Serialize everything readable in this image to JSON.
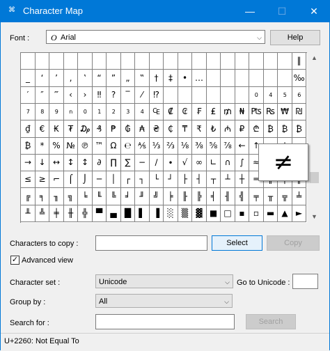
{
  "window": {
    "title": "Character Map",
    "icon": "charmap-app-icon",
    "controls": {
      "minimize": "—",
      "maximize": "☐",
      "close": "✕"
    },
    "accent_color": "#0078d7"
  },
  "font": {
    "label": "Font :",
    "value": "Arial",
    "glyph": "O",
    "help_label": "Help"
  },
  "grid": {
    "rows": [
      [
        "",
        "",
        "",
        "",
        "",
        "",
        "",
        "",
        "",
        "",
        "",
        "",
        "",
        "",
        "",
        "",
        "",
        "",
        "",
        "‖"
      ],
      [
        "_",
        "‘",
        "’",
        "‚",
        "‛",
        "“",
        "”",
        "„",
        "‟",
        "†",
        "‡",
        "•",
        "…",
        "",
        "",
        "",
        "",
        "",
        "",
        "‰"
      ],
      [
        "′",
        "″",
        "‴",
        "‹",
        "›",
        "‼",
        "?",
        "‾",
        "⁄",
        "⁉",
        "",
        "",
        "",
        "",
        "",
        "",
        "0",
        "4",
        "5",
        "6"
      ],
      [
        "7",
        "8",
        "9",
        "n",
        "0",
        "1",
        "2",
        "3",
        "4",
        "₠",
        "₡",
        "₢",
        "₣",
        "₤",
        "₥",
        "₦",
        "₧",
        "₨",
        "₩",
        "₪"
      ],
      [
        "₫",
        "€",
        "₭",
        "₮",
        "₯",
        "₰",
        "₱",
        "₲",
        "₳",
        "₴",
        "₵",
        "₸",
        "₹",
        "₺",
        "₼",
        "₽",
        "₾",
        "₿",
        "₿",
        "₿"
      ],
      [
        "₿",
        "*",
        "%",
        "№",
        "℗",
        "™",
        "Ω",
        "℮",
        "⅍",
        "⅓",
        "⅔",
        "⅛",
        "⅜",
        "⅝",
        "⅞",
        "←",
        "↑",
        "→",
        "↓",
        "↔"
      ],
      [
        "→",
        "↓",
        "↔",
        "↕",
        "↕",
        "∂",
        "∏",
        "∑",
        "−",
        "∕",
        "∙",
        "√",
        "∞",
        "∟",
        "∩",
        "∫",
        "≈",
        "≠",
        "≡",
        ""
      ],
      [
        "≤",
        "≥",
        "⌐",
        "⌠",
        "⌡",
        "─",
        "│",
        "┌",
        "┐",
        "└",
        "┘",
        "├",
        "┤",
        "┬",
        "┴",
        "┼",
        "═",
        "║",
        "╒",
        "╓"
      ],
      [
        "╔",
        "╕",
        "╖",
        "╗",
        "╘",
        "╙",
        "╚",
        "╛",
        "╜",
        "╝",
        "╞",
        "╟",
        "╠",
        "╡",
        "╢",
        "╣",
        "╤",
        "╥",
        "╦",
        "╧"
      ],
      [
        "╨",
        "╩",
        "╪",
        "╫",
        "╬",
        "▀",
        "▄",
        "█",
        "▌",
        "▐",
        "░",
        "▒",
        "▓",
        "■",
        "□",
        "▪",
        "▫",
        "▬",
        "▲",
        "►"
      ]
    ],
    "selected_glyph": "≠"
  },
  "copy": {
    "label": "Characters to copy :",
    "value": "",
    "select_label": "Select",
    "copy_label": "Copy"
  },
  "advanced": {
    "label": "Advanced view",
    "checked": "✓"
  },
  "character_set": {
    "label": "Character set :",
    "value": "Unicode",
    "goto_label": "Go to Unicode :",
    "goto_value": ""
  },
  "group_by": {
    "label": "Group by :",
    "value": "All"
  },
  "search": {
    "label": "Search for :",
    "value": "",
    "button_label": "Search"
  },
  "status": {
    "text": "U+2260: Not Equal To"
  }
}
